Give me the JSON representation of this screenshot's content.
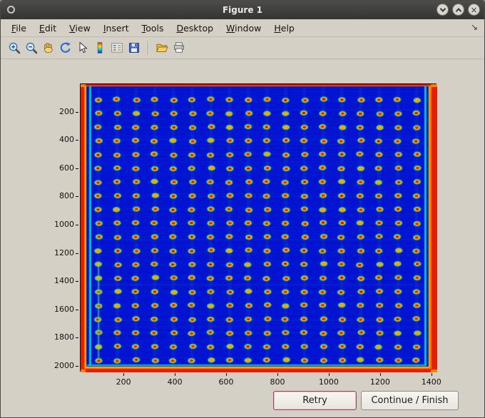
{
  "window": {
    "title": "Figure 1",
    "controls": {
      "minimize_icon": "chevron-down",
      "maximize_icon": "chevron-up",
      "close_glyph": "×"
    }
  },
  "menu": {
    "items": [
      "File",
      "Edit",
      "View",
      "Insert",
      "Tools",
      "Desktop",
      "Window",
      "Help"
    ],
    "dock_arrow_glyph": "↘"
  },
  "toolbar": {
    "icons": [
      "zoom-in",
      "zoom-out",
      "pan-hand",
      "rotate-3d",
      "data-cursor",
      "insert-colorbar",
      "insert-legend",
      "save-figure",
      "open-file",
      "print-figure"
    ]
  },
  "buttons": {
    "retry": "Retry",
    "continue_finish": "Continue / Finish"
  },
  "chart_data": {
    "type": "heatmap",
    "title": "",
    "xlabel": "",
    "ylabel": "",
    "x_ticks": [
      200,
      400,
      600,
      800,
      1000,
      1200,
      1400
    ],
    "y_ticks": [
      200,
      400,
      600,
      800,
      1000,
      1200,
      1400,
      1600,
      1800,
      2000
    ],
    "x_range": [
      30,
      1420
    ],
    "y_range": [
      0,
      2040
    ],
    "colormap": "jet",
    "background_value_color": "#0014d2",
    "description": "Pseudocolor (jet) scan of a spotted plate/microarray: deep blue field with a regular grid of spots having red centers and yellow/green rims; saturated red-orange bands along all four image edges with thin cyan stripes just inside the left, right and bottom edges.",
    "spot_grid": {
      "rows": 20,
      "cols": 18,
      "x_start": 100,
      "x_end": 1340,
      "y_start": 110,
      "y_end": 1955
    },
    "axis_box": true,
    "grid": false,
    "legend": false
  }
}
